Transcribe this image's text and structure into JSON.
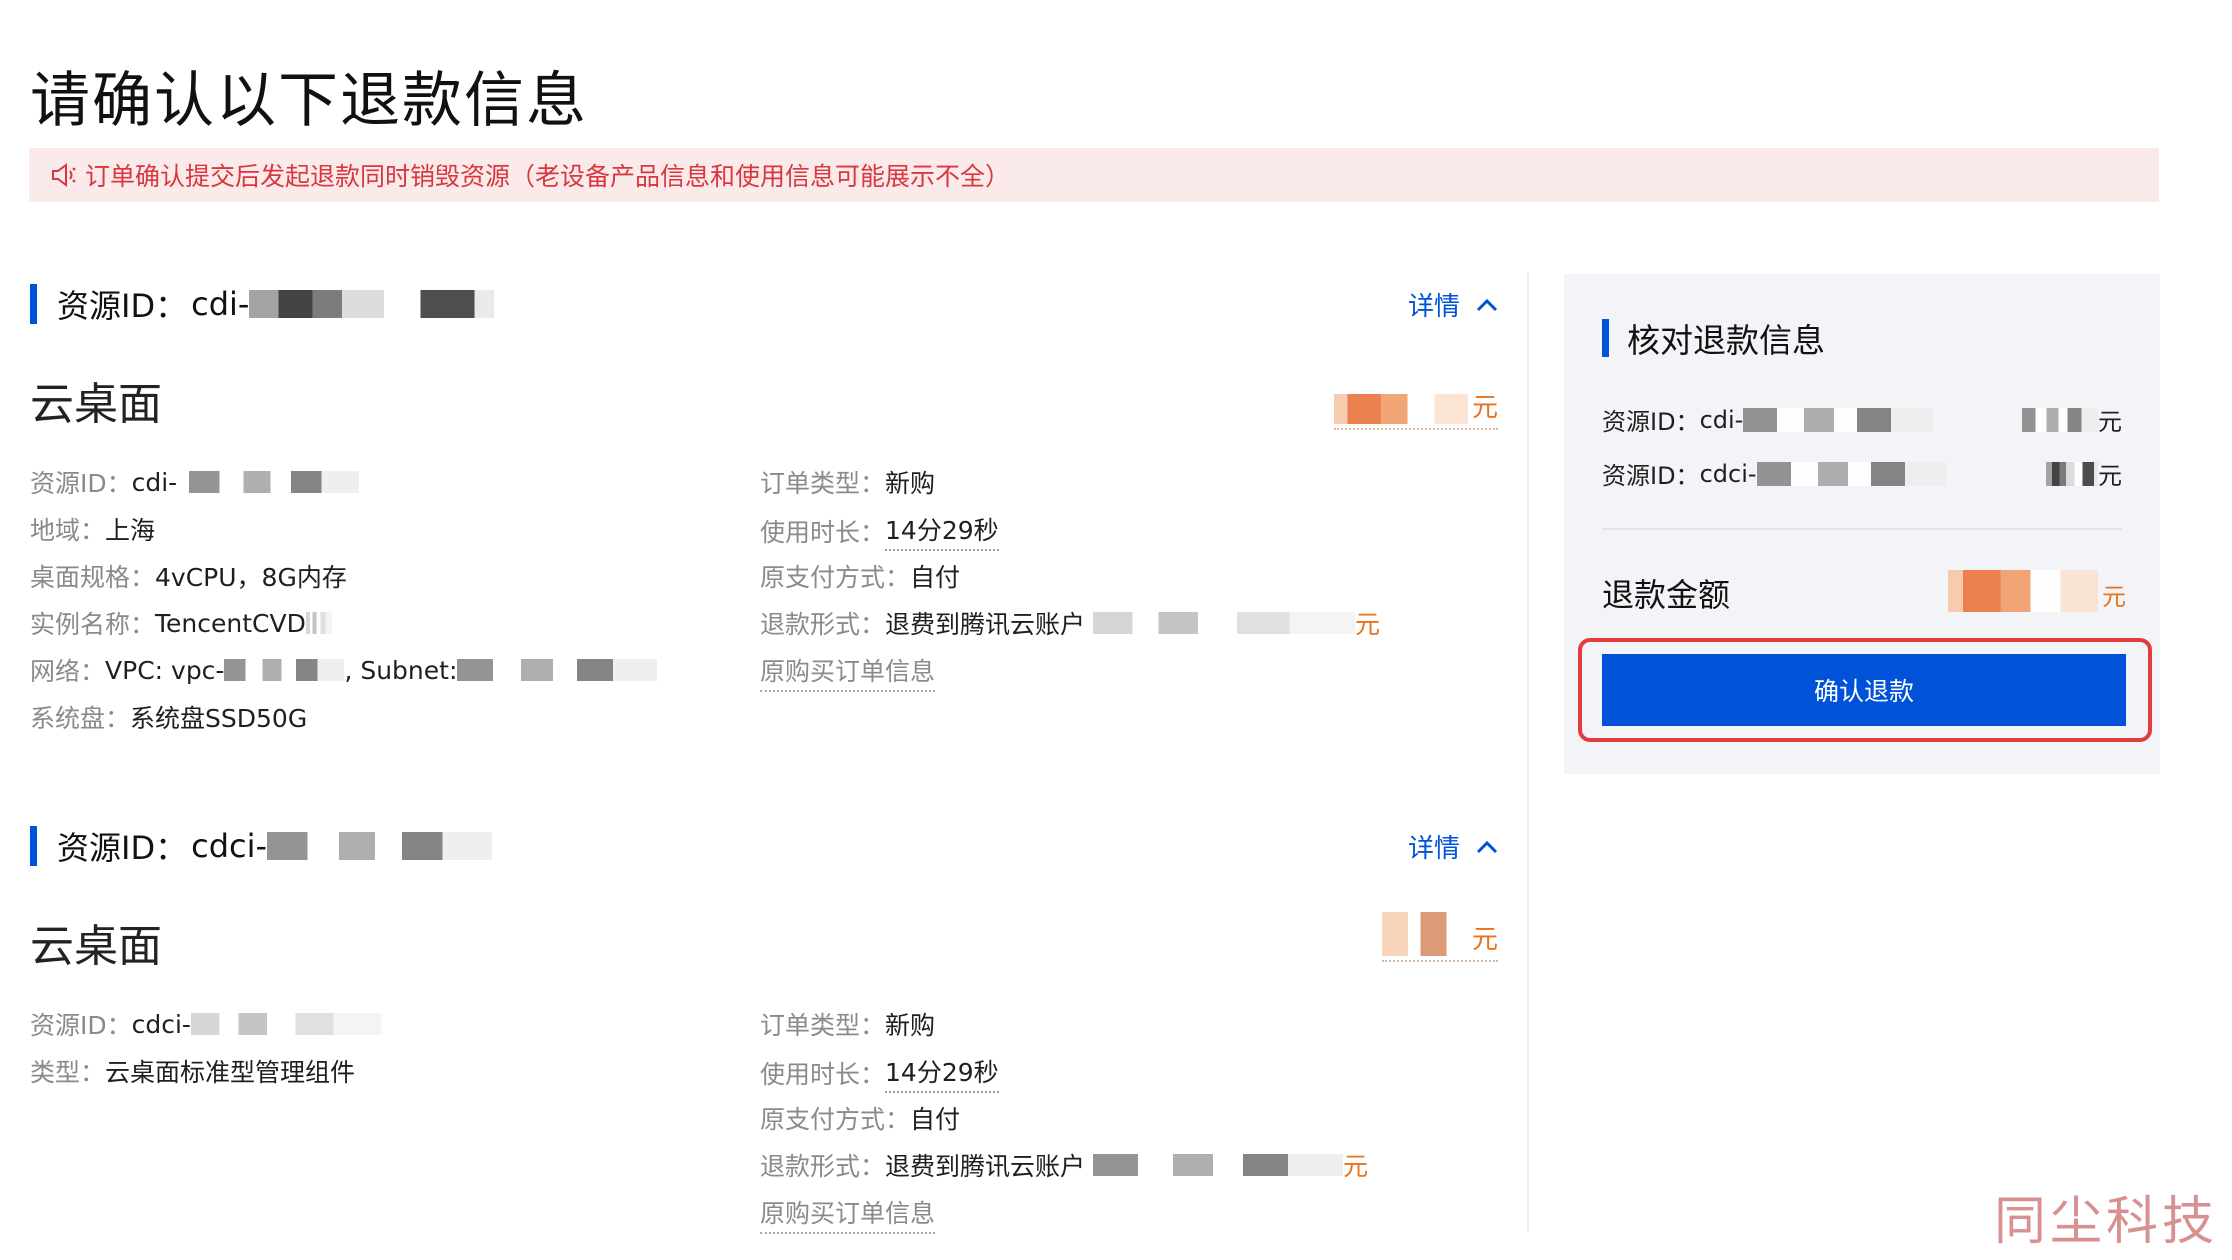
{
  "page": {
    "title": "请确认以下退款信息",
    "notice": "订单确认提交后发起退款同时销毁资源（老设备产品信息和使用信息可能展示不全）"
  },
  "resources": [
    {
      "header_label": "资源ID：",
      "header_prefix": "cdi-",
      "details_label": "详情",
      "product": "云桌面",
      "price_unit": "元",
      "left": [
        {
          "key": "资源ID：",
          "value": "cdi-"
        },
        {
          "key": "地域：",
          "value": "上海"
        },
        {
          "key": "桌面规格：",
          "value": "4vCPU，8G内存"
        },
        {
          "key": "实例名称：",
          "value": "TencentCVD"
        },
        {
          "key": "网络：",
          "value": "VPC: vpc-",
          "value2": ", Subnet:"
        },
        {
          "key": "系统盘：",
          "value": "系统盘SSD50G"
        }
      ],
      "right": [
        {
          "key": "订单类型：",
          "value": "新购"
        },
        {
          "key": "使用时长：",
          "value": "14分29秒"
        },
        {
          "key": "原支付方式：",
          "value": "自付"
        },
        {
          "key": "退款形式：",
          "value": "退费到腾讯云账户",
          "unit": "元"
        }
      ],
      "order_link": "原购买订单信息"
    },
    {
      "header_label": "资源ID：",
      "header_prefix": "cdci-",
      "details_label": "详情",
      "product": "云桌面",
      "price_unit": "元",
      "left": [
        {
          "key": "资源ID：",
          "value": "cdci-"
        },
        {
          "key": "类型：",
          "value": "云桌面标准型管理组件"
        }
      ],
      "right": [
        {
          "key": "订单类型：",
          "value": "新购"
        },
        {
          "key": "使用时长：",
          "value": "14分29秒"
        },
        {
          "key": "原支付方式：",
          "value": "自付"
        },
        {
          "key": "退款形式：",
          "value": "退费到腾讯云账户",
          "unit": "元"
        }
      ],
      "order_link": "原购买订单信息"
    }
  ],
  "summary": {
    "title": "核对退款信息",
    "rows": [
      {
        "key": "资源ID：",
        "prefix": "cdi-",
        "unit": "元"
      },
      {
        "key": "资源ID：",
        "prefix": "cdci-",
        "unit": "元"
      }
    ],
    "refund_label": "退款金额",
    "refund_unit": "元",
    "confirm_button": "确认退款"
  },
  "watermark": "同尘科技",
  "colors": {
    "primary": "#0052d9",
    "warning_text": "#d9373f",
    "warning_bg": "#fbeaea",
    "price": "#e8731b",
    "highlight_border": "#e23c3c"
  }
}
